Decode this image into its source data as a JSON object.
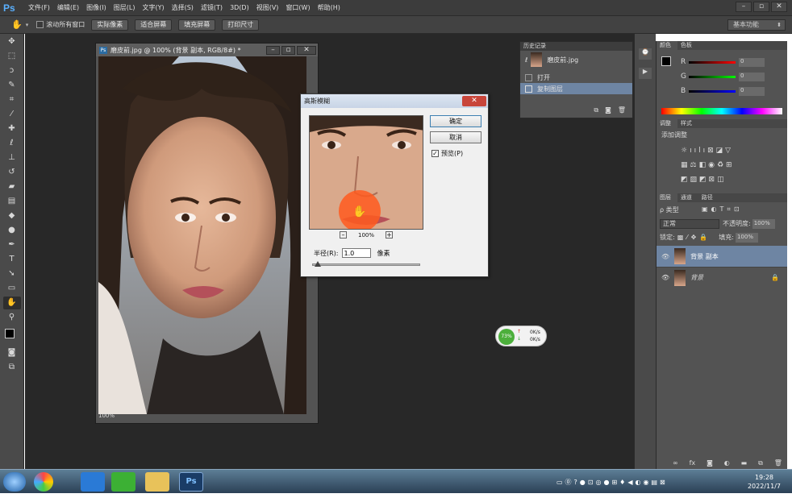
{
  "app": {
    "logo": "Ps"
  },
  "menu": [
    "文件(F)",
    "编辑(E)",
    "图像(I)",
    "图层(L)",
    "文字(Y)",
    "选择(S)",
    "滤镜(T)",
    "3D(D)",
    "视图(V)",
    "窗口(W)",
    "帮助(H)"
  ],
  "window_controls": [
    "–",
    "▫",
    "✕"
  ],
  "options_bar": {
    "scroll_all": "滚动所有窗口",
    "actual_pixels": "实际像素",
    "fit_screen": "适合屏幕",
    "fill_screen": "填充屏幕",
    "print_size": "打印尺寸",
    "workspace": "基本功能"
  },
  "document": {
    "title": "磨皮前.jpg @ 100% (背景 副本, RGB/8#) *",
    "zoom": "100%"
  },
  "dialog": {
    "title": "高斯模糊",
    "ok": "确定",
    "cancel": "取消",
    "preview_label": "预览(P)",
    "preview_checked": true,
    "zoom": "100%",
    "radius_label": "半径(R):",
    "radius_value": "1.0",
    "unit": "像素"
  },
  "history": {
    "tab": "历史记录",
    "snapshot": "磨皮前.jpg",
    "items": [
      "打开",
      "复制图层"
    ]
  },
  "color_panel": {
    "tabs": [
      "颜色",
      "色板"
    ],
    "channels": [
      "R",
      "G",
      "B"
    ],
    "values": [
      "0",
      "0",
      "0"
    ]
  },
  "adjust_panel": {
    "tabs": [
      "调整",
      "样式"
    ],
    "heading": "添加调整"
  },
  "layers_panel": {
    "tabs": [
      "图层",
      "通道",
      "路径"
    ],
    "kind": "ρ 类型",
    "blend_mode": "正常",
    "opacity_label": "不透明度:",
    "opacity": "100%",
    "lock_label": "锁定:",
    "fill_label": "填充:",
    "fill": "100%",
    "layers": [
      {
        "name": "背景 副本",
        "selected": true
      },
      {
        "name": "背景",
        "selected": false
      }
    ]
  },
  "net_widget": {
    "percent": "73%",
    "up": "0K/s",
    "down": "0K/s"
  },
  "clock": {
    "time": "19:28",
    "date": "2022/11/7"
  }
}
